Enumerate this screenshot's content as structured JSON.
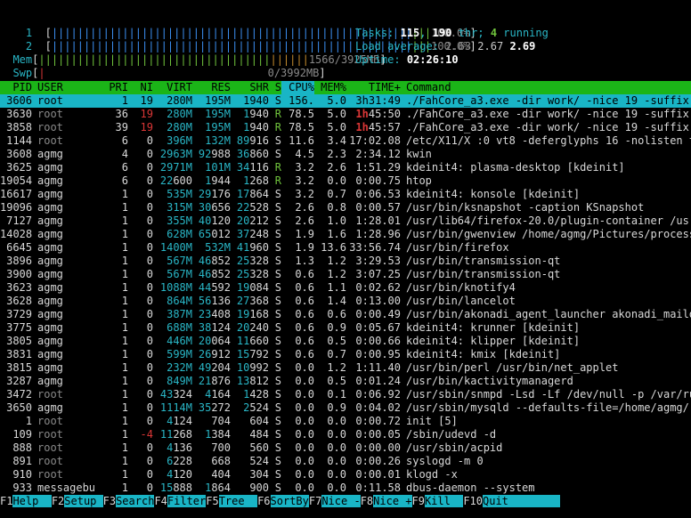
{
  "cpu1": {
    "label": "1",
    "bar": "||||||||||||||||||||||||||||||||||||||||||||||||||||||||",
    "tail": "|||",
    "pct": "100.0%"
  },
  "cpu2": {
    "label": "2",
    "bar": "||||||||||||||||||||||||||||||||||||||||||||||||||||||||",
    "tail": "|||",
    "pct": "100.0%"
  },
  "mem": {
    "label": "Mem",
    "bar_used": "||||||||||||||||||||||||||||||||||||",
    "bar_buf": "||||||",
    "text": "1566/3925MB"
  },
  "swp": {
    "label": "Swp",
    "bar": "|",
    "text": "0/3992MB"
  },
  "tasks": {
    "label": "Tasks:",
    "count": "115",
    "sep1": ",",
    "thr": "190",
    "thr_label": "thr;",
    "running": "4",
    "running_label": "running"
  },
  "load": {
    "label": "Load average:",
    "v1": "2.63",
    "v2": "2.67",
    "v3": "2.69"
  },
  "uptime": {
    "label": "Uptime:",
    "value": "02:26:10"
  },
  "columns": [
    "PID",
    "USER",
    "PRI",
    "NI",
    "VIRT",
    "RES",
    "SHR",
    "S",
    "CPU%",
    "MEM%",
    "TIME+",
    "Command"
  ],
  "processes": [
    {
      "pid": "3606",
      "user": "root",
      "pri": "1",
      "ni": "19",
      "virt": "280M",
      "res": "195M",
      "shr": "1940",
      "s": "S",
      "cpu": "156.",
      "mem": "5.0",
      "time": "3h31:49",
      "cmd": "./FahCore_a3.exe -dir work/ -nice 19 -suffix 08"
    },
    {
      "pid": "3630",
      "user": "root",
      "pri": "36",
      "ni": "19",
      "virt": "280M",
      "res": "195M",
      "shr": "1940",
      "s": "R",
      "cpu": "78.5",
      "mem": "5.0",
      "time": "1h45:50",
      "cmd": "./FahCore_a3.exe -dir work/ -nice 19 -suffix 08"
    },
    {
      "pid": "3858",
      "user": "root",
      "pri": "39",
      "ni": "19",
      "virt": "280M",
      "res": "195M",
      "shr": "1940",
      "s": "R",
      "cpu": "78.5",
      "mem": "5.0",
      "time": "1h45:57",
      "cmd": "./FahCore_a3.exe -dir work/ -nice 19 -suffix 08"
    },
    {
      "pid": "1144",
      "user": "root",
      "pri": "6",
      "ni": "0",
      "virt": "396M",
      "res": "132M",
      "shr": "89916",
      "s": "S",
      "cpu": "11.6",
      "mem": "3.4",
      "time": "17:02.08",
      "cmd": "/etc/X11/X :0 vt8 -deferglyphs 16 -nolisten tcp"
    },
    {
      "pid": "3608",
      "user": "agmg",
      "pri": "4",
      "ni": "0",
      "virt": "2963M",
      "res": "92988",
      "shr": "36860",
      "s": "S",
      "cpu": "4.5",
      "mem": "2.3",
      "time": "2:34.12",
      "cmd": "kwin"
    },
    {
      "pid": "3625",
      "user": "agmg",
      "pri": "6",
      "ni": "0",
      "virt": "2971M",
      "res": "101M",
      "shr": "34116",
      "s": "R",
      "cpu": "3.2",
      "mem": "2.6",
      "time": "1:51.29",
      "cmd": "kdeinit4: plasma-desktop [kdeinit]"
    },
    {
      "pid": "19054",
      "user": "agmg",
      "pri": "6",
      "ni": "0",
      "virt": "22600",
      "res": "1944",
      "shr": "1268",
      "s": "R",
      "cpu": "3.2",
      "mem": "0.0",
      "time": "0:00.75",
      "cmd": "htop"
    },
    {
      "pid": "16617",
      "user": "agmg",
      "pri": "1",
      "ni": "0",
      "virt": "535M",
      "res": "29176",
      "shr": "17864",
      "s": "S",
      "cpu": "3.2",
      "mem": "0.7",
      "time": "0:06.53",
      "cmd": "kdeinit4: konsole [kdeinit]"
    },
    {
      "pid": "19096",
      "user": "agmg",
      "pri": "1",
      "ni": "0",
      "virt": "315M",
      "res": "30656",
      "shr": "22528",
      "s": "S",
      "cpu": "2.6",
      "mem": "0.8",
      "time": "0:00.57",
      "cmd": "/usr/bin/ksnapshot -caption KSnapshot"
    },
    {
      "pid": "7127",
      "user": "agmg",
      "pri": "1",
      "ni": "0",
      "virt": "355M",
      "res": "40120",
      "shr": "20212",
      "s": "S",
      "cpu": "2.6",
      "mem": "1.0",
      "time": "1:28.01",
      "cmd": "/usr/lib64/firefox-20.0/plugin-container /usr/l"
    },
    {
      "pid": "14028",
      "user": "agmg",
      "pri": "1",
      "ni": "0",
      "virt": "628M",
      "res": "65012",
      "shr": "37248",
      "s": "S",
      "cpu": "1.9",
      "mem": "1.6",
      "time": "1:28.96",
      "cmd": "/usr/bin/gwenview /home/agmg/Pictures/processes"
    },
    {
      "pid": "6645",
      "user": "agmg",
      "pri": "1",
      "ni": "0",
      "virt": "1400M",
      "res": "532M",
      "shr": "41960",
      "s": "S",
      "cpu": "1.9",
      "mem": "13.6",
      "time": "33:56.74",
      "cmd": "/usr/bin/firefox"
    },
    {
      "pid": "3896",
      "user": "agmg",
      "pri": "1",
      "ni": "0",
      "virt": "567M",
      "res": "46852",
      "shr": "25328",
      "s": "S",
      "cpu": "1.3",
      "mem": "1.2",
      "time": "3:29.53",
      "cmd": "/usr/bin/transmission-qt"
    },
    {
      "pid": "3900",
      "user": "agmg",
      "pri": "1",
      "ni": "0",
      "virt": "567M",
      "res": "46852",
      "shr": "25328",
      "s": "S",
      "cpu": "0.6",
      "mem": "1.2",
      "time": "3:07.25",
      "cmd": "/usr/bin/transmission-qt"
    },
    {
      "pid": "3623",
      "user": "agmg",
      "pri": "1",
      "ni": "0",
      "virt": "1088M",
      "res": "44592",
      "shr": "19084",
      "s": "S",
      "cpu": "0.6",
      "mem": "1.1",
      "time": "0:02.62",
      "cmd": "/usr/bin/knotify4"
    },
    {
      "pid": "3628",
      "user": "agmg",
      "pri": "1",
      "ni": "0",
      "virt": "864M",
      "res": "56136",
      "shr": "27368",
      "s": "S",
      "cpu": "0.6",
      "mem": "1.4",
      "time": "0:13.00",
      "cmd": "/usr/bin/lancelot"
    },
    {
      "pid": "3729",
      "user": "agmg",
      "pri": "1",
      "ni": "0",
      "virt": "387M",
      "res": "23408",
      "shr": "19168",
      "s": "S",
      "cpu": "0.6",
      "mem": "0.6",
      "time": "0:00.49",
      "cmd": "/usr/bin/akonadi_agent_launcher akonadi_maildir"
    },
    {
      "pid": "3775",
      "user": "agmg",
      "pri": "1",
      "ni": "0",
      "virt": "688M",
      "res": "38124",
      "shr": "20240",
      "s": "S",
      "cpu": "0.6",
      "mem": "0.9",
      "time": "0:05.67",
      "cmd": "kdeinit4: krunner [kdeinit]"
    },
    {
      "pid": "3805",
      "user": "agmg",
      "pri": "1",
      "ni": "0",
      "virt": "446M",
      "res": "20064",
      "shr": "11660",
      "s": "S",
      "cpu": "0.6",
      "mem": "0.5",
      "time": "0:00.66",
      "cmd": "kdeinit4: klipper [kdeinit]"
    },
    {
      "pid": "3831",
      "user": "agmg",
      "pri": "1",
      "ni": "0",
      "virt": "599M",
      "res": "26912",
      "shr": "15792",
      "s": "S",
      "cpu": "0.6",
      "mem": "0.7",
      "time": "0:00.95",
      "cmd": "kdeinit4: kmix [kdeinit]"
    },
    {
      "pid": "3815",
      "user": "agmg",
      "pri": "1",
      "ni": "0",
      "virt": "232M",
      "res": "49204",
      "shr": "10992",
      "s": "S",
      "cpu": "0.0",
      "mem": "1.2",
      "time": "1:11.40",
      "cmd": "/usr/bin/perl /usr/bin/net_applet"
    },
    {
      "pid": "3287",
      "user": "agmg",
      "pri": "1",
      "ni": "0",
      "virt": "849M",
      "res": "21876",
      "shr": "13812",
      "s": "S",
      "cpu": "0.0",
      "mem": "0.5",
      "time": "0:01.24",
      "cmd": "/usr/bin/kactivitymanagerd"
    },
    {
      "pid": "3472",
      "user": "root",
      "pri": "1",
      "ni": "0",
      "virt": "43324",
      "res": "4164",
      "shr": "1428",
      "s": "S",
      "cpu": "0.0",
      "mem": "0.1",
      "time": "0:06.92",
      "cmd": "/usr/sbin/snmpd -Lsd -Lf /dev/null -p /var/run/"
    },
    {
      "pid": "3650",
      "user": "agmg",
      "pri": "1",
      "ni": "0",
      "virt": "1114M",
      "res": "35272",
      "shr": "2524",
      "s": "S",
      "cpu": "0.0",
      "mem": "0.9",
      "time": "0:04.02",
      "cmd": "/usr/sbin/mysqld --defaults-file=/home/agmg/.lo"
    },
    {
      "pid": "1",
      "user": "root",
      "pri": "1",
      "ni": "0",
      "virt": "4124",
      "res": "704",
      "shr": "604",
      "s": "S",
      "cpu": "0.0",
      "mem": "0.0",
      "time": "0:00.72",
      "cmd": "init [5]"
    },
    {
      "pid": "109",
      "user": "root",
      "pri": "1",
      "ni": "-4",
      "virt": "11268",
      "res": "1384",
      "shr": "484",
      "s": "S",
      "cpu": "0.0",
      "mem": "0.0",
      "time": "0:00.05",
      "cmd": "/sbin/udevd -d"
    },
    {
      "pid": "888",
      "user": "root",
      "pri": "1",
      "ni": "0",
      "virt": "4136",
      "res": "700",
      "shr": "560",
      "s": "S",
      "cpu": "0.0",
      "mem": "0.0",
      "time": "0:00.00",
      "cmd": "/usr/sbin/acpid"
    },
    {
      "pid": "891",
      "user": "root",
      "pri": "1",
      "ni": "0",
      "virt": "6228",
      "res": "668",
      "shr": "524",
      "s": "S",
      "cpu": "0.0",
      "mem": "0.0",
      "time": "0:00.26",
      "cmd": "syslogd -m 0"
    },
    {
      "pid": "910",
      "user": "root",
      "pri": "1",
      "ni": "0",
      "virt": "4120",
      "res": "404",
      "shr": "304",
      "s": "S",
      "cpu": "0.0",
      "mem": "0.0",
      "time": "0:00.01",
      "cmd": "klogd -x"
    },
    {
      "pid": "933",
      "user": "messagebu",
      "pri": "1",
      "ni": "0",
      "virt": "15888",
      "res": "1864",
      "shr": "900",
      "s": "S",
      "cpu": "0.0",
      "mem": "0.0",
      "time": "0:11.58",
      "cmd": "dbus-daemon --system"
    }
  ],
  "footer": [
    {
      "key": "F1",
      "label": "Help  "
    },
    {
      "key": "F2",
      "label": "Setup "
    },
    {
      "key": "F3",
      "label": "Search"
    },
    {
      "key": "F4",
      "label": "Filter"
    },
    {
      "key": "F5",
      "label": "Tree  "
    },
    {
      "key": "F6",
      "label": "SortBy"
    },
    {
      "key": "F7",
      "label": "Nice -"
    },
    {
      "key": "F8",
      "label": "Nice +"
    },
    {
      "key": "F9",
      "label": "Kill  "
    },
    {
      "key": "F10",
      "label": "Quit        "
    }
  ]
}
